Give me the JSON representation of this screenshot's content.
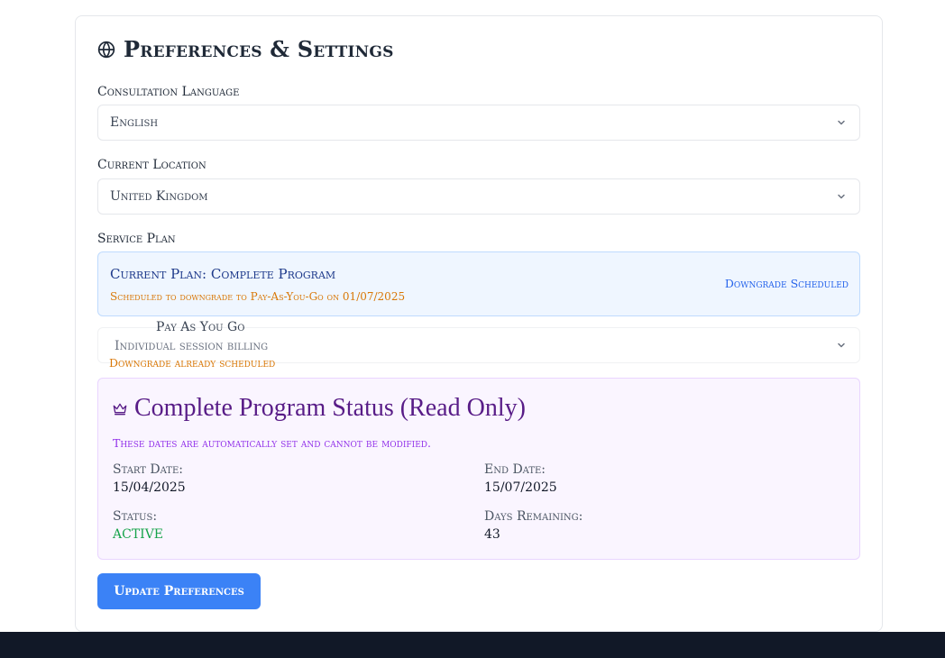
{
  "header": {
    "title": "Preferences & Settings",
    "icon": "globe-icon"
  },
  "language": {
    "label": "Consultation Language",
    "selected": "English"
  },
  "location": {
    "label": "Current Location",
    "selected": "United Kingdom"
  },
  "service_plan": {
    "label": "Service Plan",
    "current": "Current Plan: Complete Program",
    "scheduled_note": "Scheduled to downgrade to Pay-As-You-Go on 01/07/2025",
    "badge": "Downgrade Scheduled",
    "option": {
      "title": "Pay As You Go",
      "subtitle": "Individual session billing",
      "note": "Downgrade already scheduled"
    }
  },
  "program_status": {
    "icon": "crown-icon",
    "title": "Complete Program Status (Read Only)",
    "note": "These dates are automatically set and cannot be modified.",
    "start_label": "Start Date:",
    "start_value": "15/04/2025",
    "end_label": "End Date:",
    "end_value": "15/07/2025",
    "status_label": "Status:",
    "status_value": "ACTIVE",
    "days_label": "Days Remaining:",
    "days_value": "43"
  },
  "actions": {
    "update_label": "Update Preferences"
  },
  "colors": {
    "accent": "#3b82f6",
    "warning": "#d97706",
    "purple": "#581c87",
    "success": "#16a34a",
    "footer": "#111827"
  }
}
